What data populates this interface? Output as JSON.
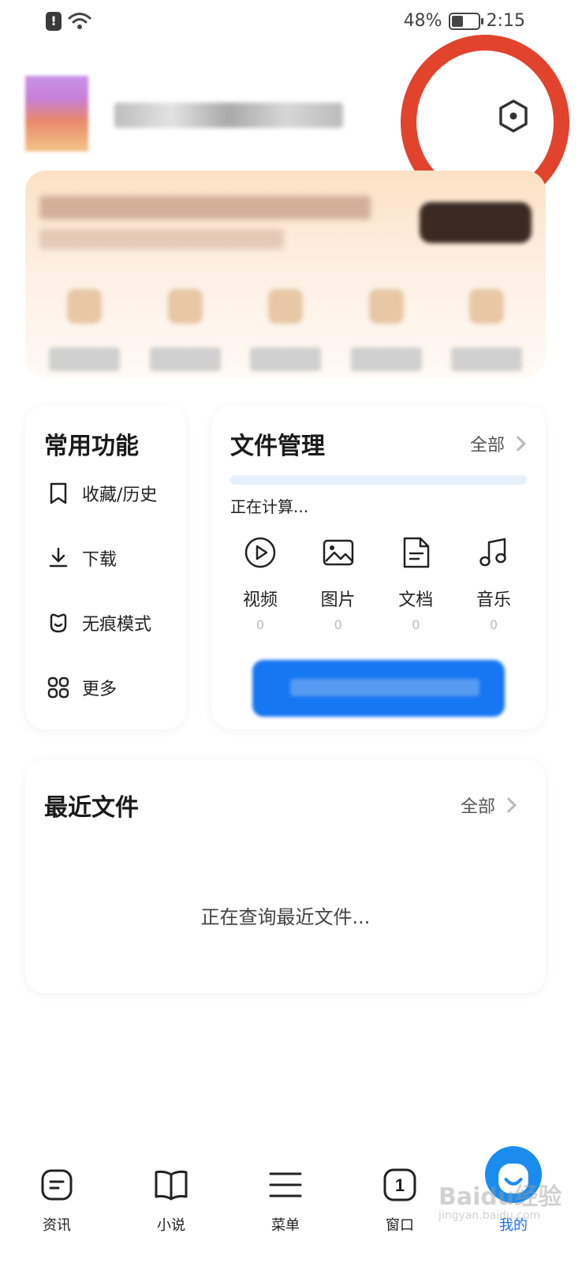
{
  "status_bar": {
    "battery": "48%",
    "time": "2:15"
  },
  "common_functions": {
    "title": "常用功能",
    "items": [
      {
        "label": "收藏/历史",
        "icon": "bookmark-icon"
      },
      {
        "label": "下载",
        "icon": "download-icon"
      },
      {
        "label": "无痕模式",
        "icon": "incognito-icon"
      },
      {
        "label": "更多",
        "icon": "grid-icon"
      }
    ]
  },
  "file_management": {
    "title": "文件管理",
    "all_label": "全部",
    "status": "正在计算...",
    "types": [
      {
        "label": "视频",
        "count": "0",
        "icon": "video-icon"
      },
      {
        "label": "图片",
        "count": "0",
        "icon": "image-icon"
      },
      {
        "label": "文档",
        "count": "0",
        "icon": "document-icon"
      },
      {
        "label": "音乐",
        "count": "0",
        "icon": "music-icon"
      }
    ]
  },
  "recent_files": {
    "title": "最近文件",
    "all_label": "全部",
    "status": "正在查询最近文件..."
  },
  "bottom_nav": {
    "items": [
      {
        "label": "资讯",
        "icon": "news-icon"
      },
      {
        "label": "小说",
        "icon": "book-icon"
      },
      {
        "label": "菜单",
        "icon": "menu-icon"
      },
      {
        "label": "窗口",
        "icon": "window-count-icon",
        "badge": "1"
      },
      {
        "label": "我的",
        "icon": "profile-avatar-icon",
        "active": true
      }
    ]
  },
  "watermark": {
    "text": "Baidu经验",
    "sub": "jingyan.baidu.com"
  },
  "colors": {
    "accent": "#1e6ff2",
    "highlight_ring": "#e2432d",
    "promo_bg": "#fde1c4"
  }
}
